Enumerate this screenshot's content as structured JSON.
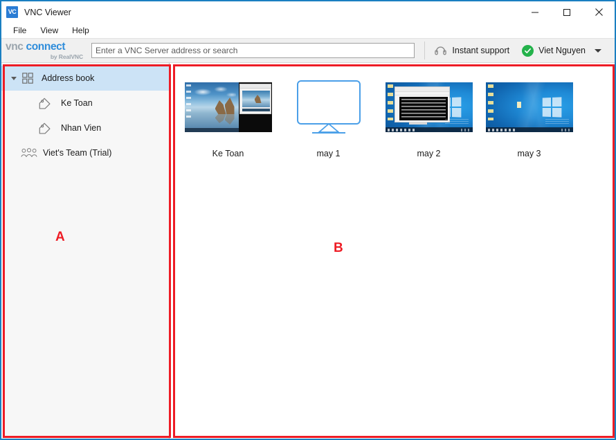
{
  "window": {
    "title": "VNC Viewer",
    "app_icon": "vnc-logo-icon",
    "minimize_label": "Minimize",
    "maximize_label": "Maximize",
    "close_label": "Close"
  },
  "menubar": {
    "items": [
      {
        "label": "File"
      },
      {
        "label": "View"
      },
      {
        "label": "Help"
      }
    ]
  },
  "toolbar": {
    "brand": {
      "vnc": "vnc",
      "connect": "connect",
      "subtitle": "by RealVNC"
    },
    "search": {
      "value": "",
      "placeholder": "Enter a VNC Server address or search"
    },
    "instant_support": {
      "label": "Instant support",
      "icon": "headset-icon"
    },
    "account": {
      "label": "Viet Nguyen",
      "status_icon": "green-check-circle-icon",
      "dropdown_icon": "caret-down-icon"
    }
  },
  "sidebar": {
    "items": [
      {
        "label": "Address book",
        "icon": "grid-icon",
        "selected": true,
        "expanded": true,
        "level": 0
      },
      {
        "label": "Ke Toan",
        "icon": "tag-icon",
        "selected": false,
        "level": 1
      },
      {
        "label": "Nhan Vien",
        "icon": "tag-icon",
        "selected": false,
        "level": 1
      },
      {
        "label": "Viet's Team (Trial)",
        "icon": "people-icon",
        "selected": false,
        "level": 0
      }
    ]
  },
  "content": {
    "thumbnails": [
      {
        "label": "Ke Toan",
        "thumb": "dual-monitor-beach-desktop"
      },
      {
        "label": "may 1",
        "thumb": "empty-monitor-outline-icon"
      },
      {
        "label": "may 2",
        "thumb": "windows10-desktop-with-console"
      },
      {
        "label": "may 3",
        "thumb": "windows10-desktop"
      }
    ]
  },
  "annotations": [
    {
      "letter": "A",
      "target": "sidebar-panel"
    },
    {
      "letter": "B",
      "target": "content-panel"
    }
  ],
  "colors": {
    "accent_blue": "#2f8ddb",
    "window_border": "#1a7fc1",
    "selection_blue": "#cce3f6",
    "annotation_red": "#ee1c25",
    "status_green": "#24b24b"
  }
}
